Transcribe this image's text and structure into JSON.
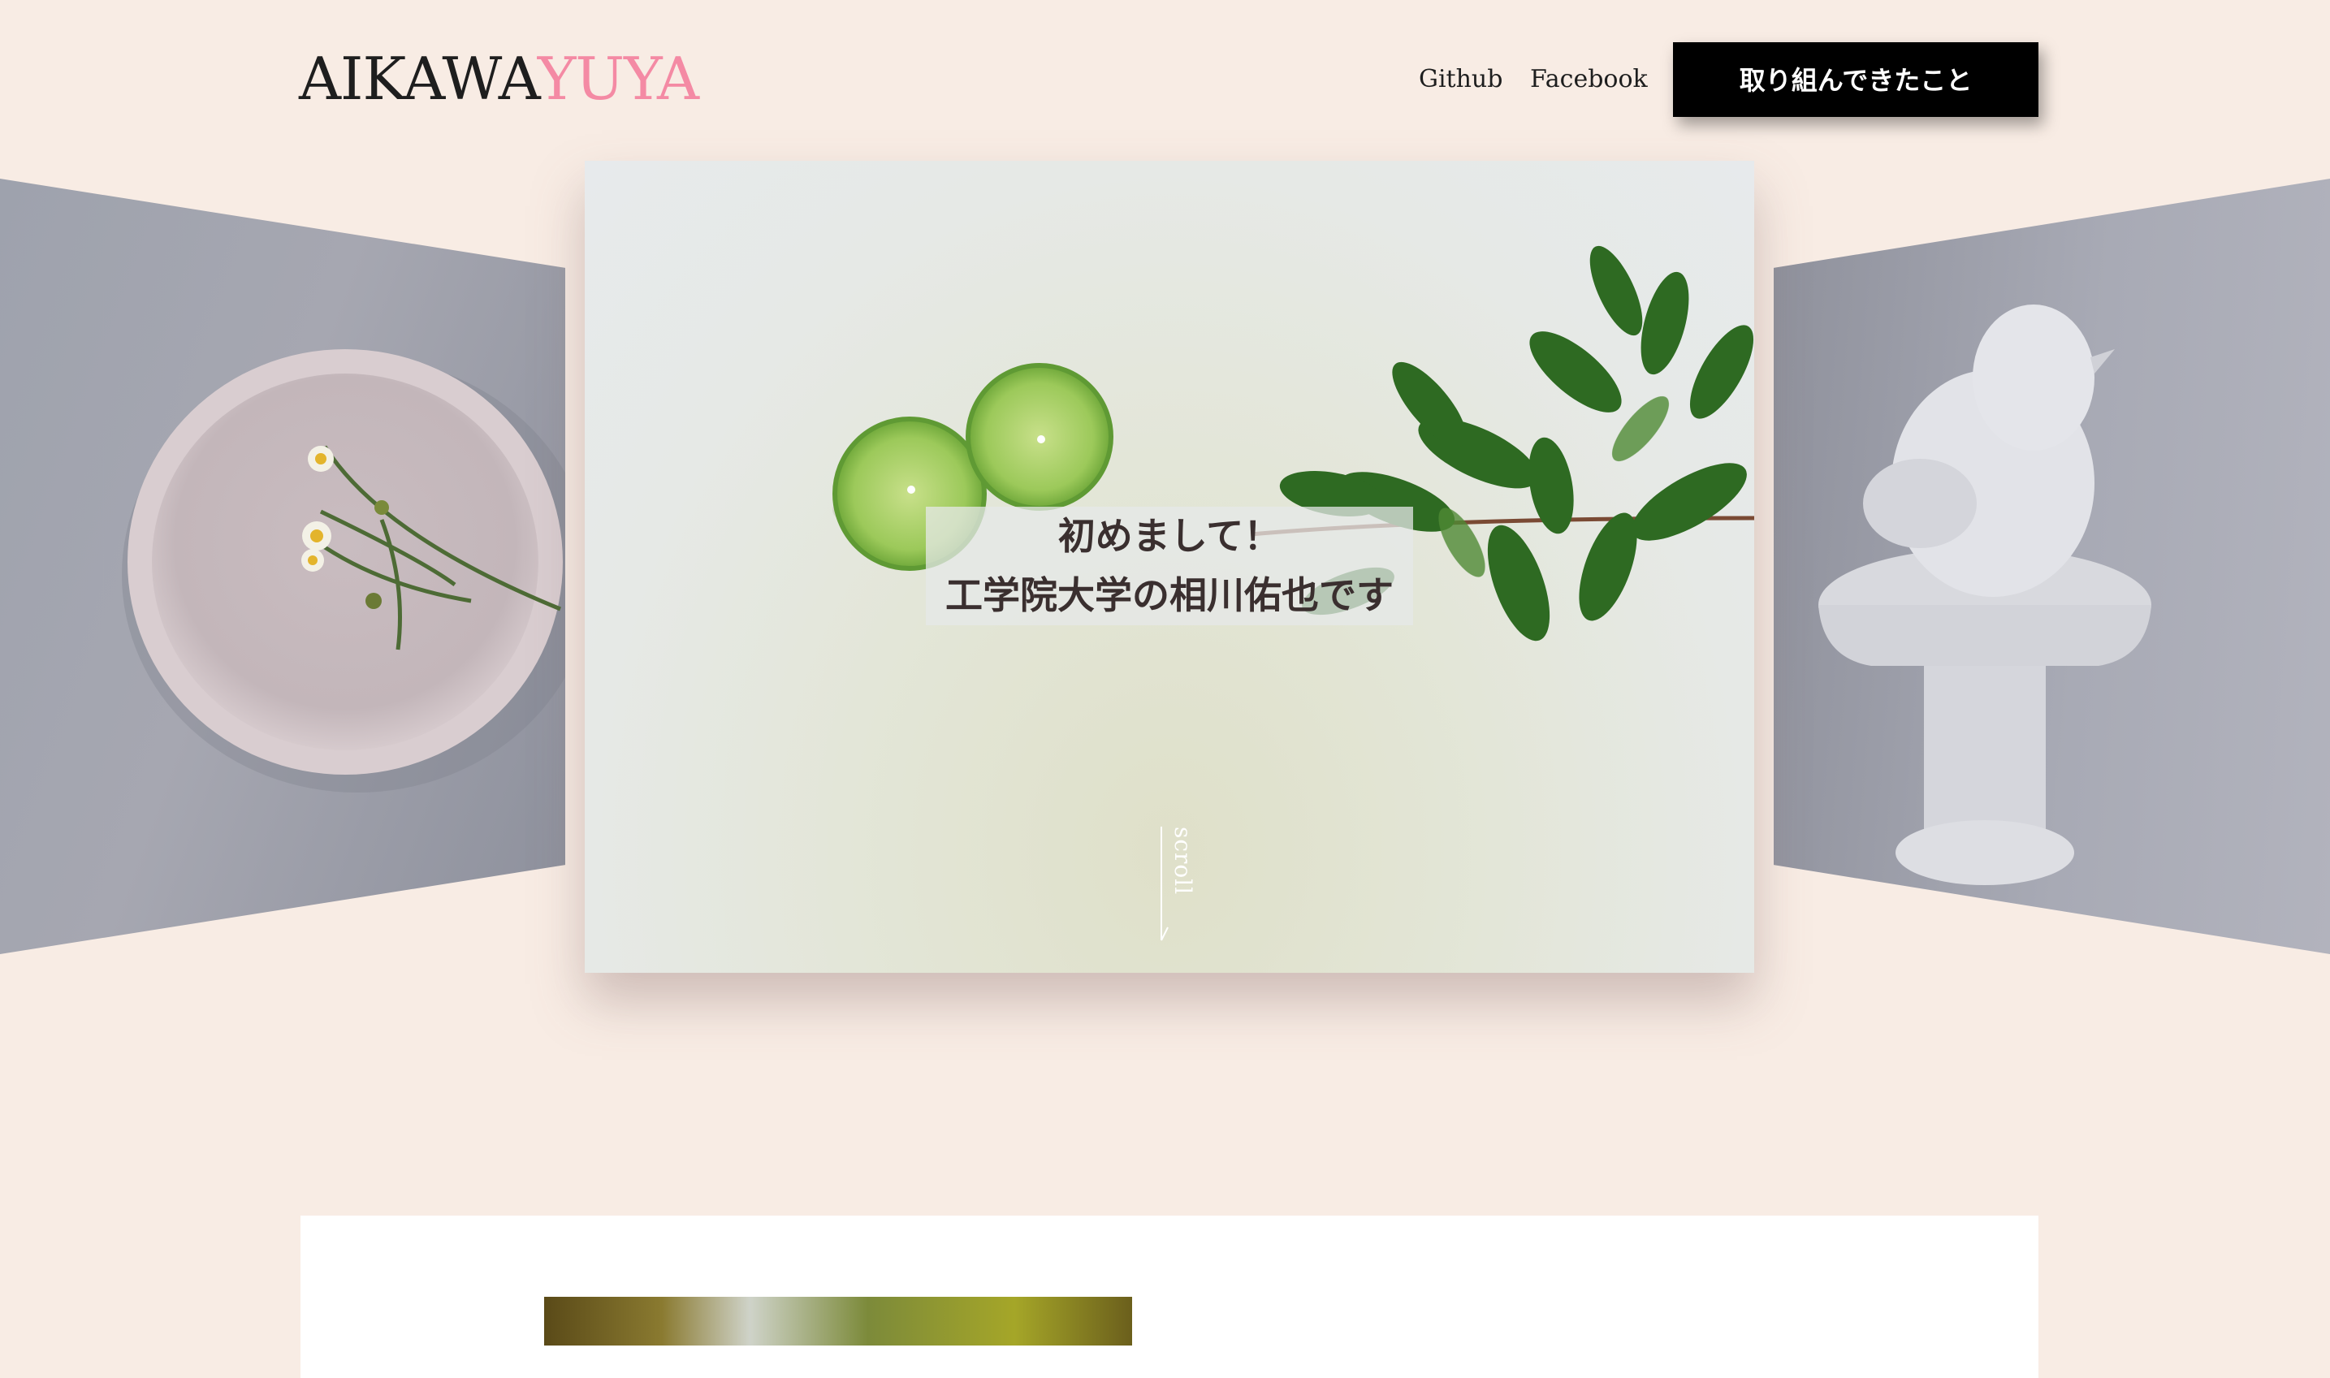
{
  "header": {
    "logo_first": "AIKAWA",
    "logo_second": "YUYA",
    "nav": [
      {
        "label": "Github"
      },
      {
        "label": "Facebook"
      }
    ],
    "cta_label": "取り組んできたこと"
  },
  "hero": {
    "line1": "初めまして！",
    "line2": "工学院大学の相川佑也です",
    "scroll_label": "scroll"
  },
  "colors": {
    "background": "#f8ece4",
    "logo_accent": "#f48aa4",
    "cta_bg": "#000000"
  },
  "icons": {
    "scroll": "arrow-down-icon"
  }
}
